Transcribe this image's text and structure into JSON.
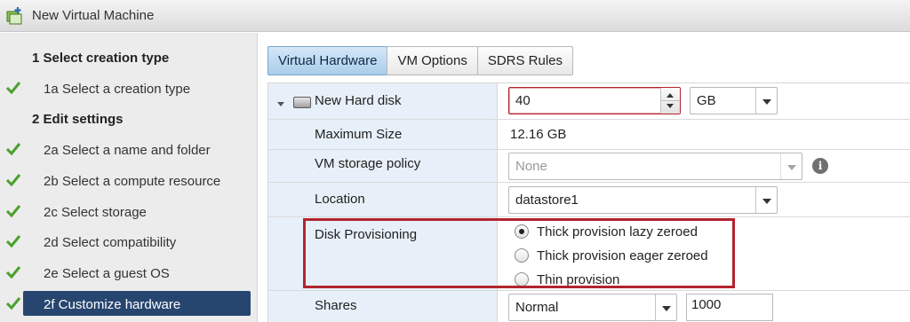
{
  "window": {
    "title": "New Virtual Machine",
    "icon": "new-vm-icon"
  },
  "nav": {
    "items": [
      {
        "kind": "group",
        "label": "1  Select creation type",
        "done": false
      },
      {
        "kind": "step",
        "label": "1a  Select a creation type",
        "done": true
      },
      {
        "kind": "group",
        "label": "2  Edit settings",
        "done": false
      },
      {
        "kind": "step",
        "label": "2a  Select a name and folder",
        "done": true
      },
      {
        "kind": "step",
        "label": "2b  Select a compute resource",
        "done": true
      },
      {
        "kind": "step",
        "label": "2c  Select storage",
        "done": true
      },
      {
        "kind": "step",
        "label": "2d  Select compatibility",
        "done": true
      },
      {
        "kind": "step",
        "label": "2e  Select a guest OS",
        "done": true
      },
      {
        "kind": "step",
        "label": "2f  Customize hardware",
        "done": true,
        "active": true
      }
    ],
    "check_color": "#4aa02c",
    "active_color": "#27466f"
  },
  "tabs": [
    {
      "label": "Virtual Hardware",
      "active": true
    },
    {
      "label": "VM Options",
      "active": false
    },
    {
      "label": "SDRS Rules",
      "active": false
    }
  ],
  "hardware": {
    "disk_label": "New Hard disk",
    "disk_size": "40",
    "disk_unit": "GB",
    "max_size_label": "Maximum Size",
    "max_size_value": "12.16 GB",
    "storage_policy_label": "VM storage policy",
    "storage_policy_value": "None",
    "location_label": "Location",
    "location_value": "datastore1",
    "provisioning_label": "Disk Provisioning",
    "provisioning_options": [
      {
        "label": "Thick provision lazy zeroed",
        "selected": true
      },
      {
        "label": "Thick provision eager zeroed",
        "selected": false
      },
      {
        "label": "Thin provision",
        "selected": false
      }
    ],
    "shares_label": "Shares",
    "shares_value": "Normal",
    "shares_number": "1000"
  },
  "colors": {
    "highlight_border": "#b3242e",
    "label_column_bg": "#e7f0f8",
    "active_tab": "#a9cdea"
  }
}
